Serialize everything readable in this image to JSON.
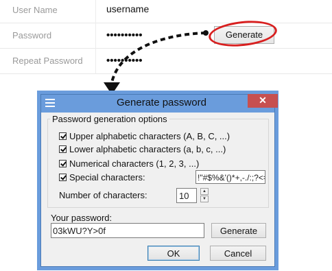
{
  "form": {
    "rows": [
      {
        "label": "User Name",
        "value": "username"
      },
      {
        "label": "Password",
        "value": "••••••••••"
      },
      {
        "label": "Repeat Password",
        "value": "••••••••••"
      }
    ],
    "generate_label": "Generate"
  },
  "dialog": {
    "title": "Generate password",
    "close_glyph": "✕",
    "group_title": "Password generation options",
    "options": [
      {
        "label": "Upper alphabetic characters (A, B, C, ...)",
        "checked": true
      },
      {
        "label": "Lower alphabetic characters (a, b, c, ...)",
        "checked": true
      },
      {
        "label": "Numerical characters (1, 2, 3, ...)",
        "checked": true
      },
      {
        "label": "Special characters:",
        "checked": true
      }
    ],
    "special_chars_value": "!\"#$%&'()*+,-./:;?<=>?@[\\]^_",
    "num_chars_label": "Number of characters:",
    "num_chars_value": "10",
    "your_password_label": "Your password:",
    "your_password_value": "03kWU?Y>0f",
    "generate_label": "Generate",
    "ok_label": "OK",
    "cancel_label": "Cancel"
  },
  "colors": {
    "titlebar": "#6a9cdc",
    "close": "#c75050",
    "highlight_ring": "#d81f1f"
  }
}
